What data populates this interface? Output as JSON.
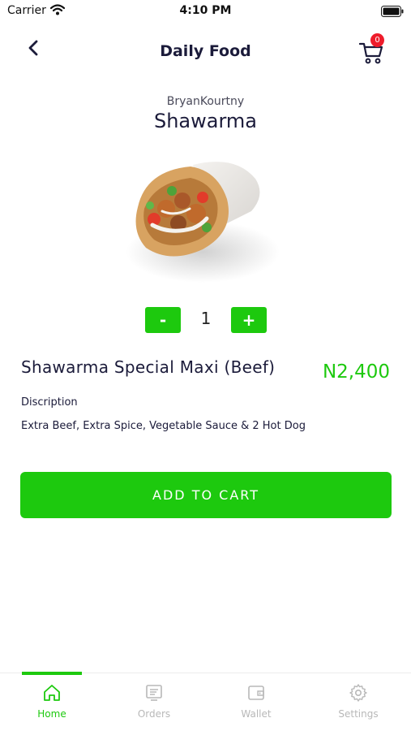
{
  "status_bar": {
    "carrier": "Carrier",
    "time": "4:10 PM"
  },
  "header": {
    "title": "Daily Food",
    "cart_count": "0"
  },
  "product": {
    "vendor": "BryanKourtny",
    "name": "Shawarma",
    "quantity": "1",
    "minus_label": "-",
    "plus_label": "+",
    "title": "Shawarma Special Maxi (Beef)",
    "price": "N2,400",
    "description_label": "Discription",
    "description": "Extra Beef, Extra Spice, Vegetable Sauce & 2 Hot Dog"
  },
  "actions": {
    "add_to_cart": "ADD TO CART"
  },
  "tabs": [
    {
      "label": "Home",
      "icon": "home-icon",
      "active": true
    },
    {
      "label": "Orders",
      "icon": "receipt-icon",
      "active": false
    },
    {
      "label": "Wallet",
      "icon": "wallet-icon",
      "active": false
    },
    {
      "label": "Settings",
      "icon": "gear-icon",
      "active": false
    }
  ],
  "colors": {
    "accent": "#1dc90e",
    "badge": "#ee1c2b",
    "text": "#1b1b3a",
    "inactive": "#b8b8b8"
  }
}
